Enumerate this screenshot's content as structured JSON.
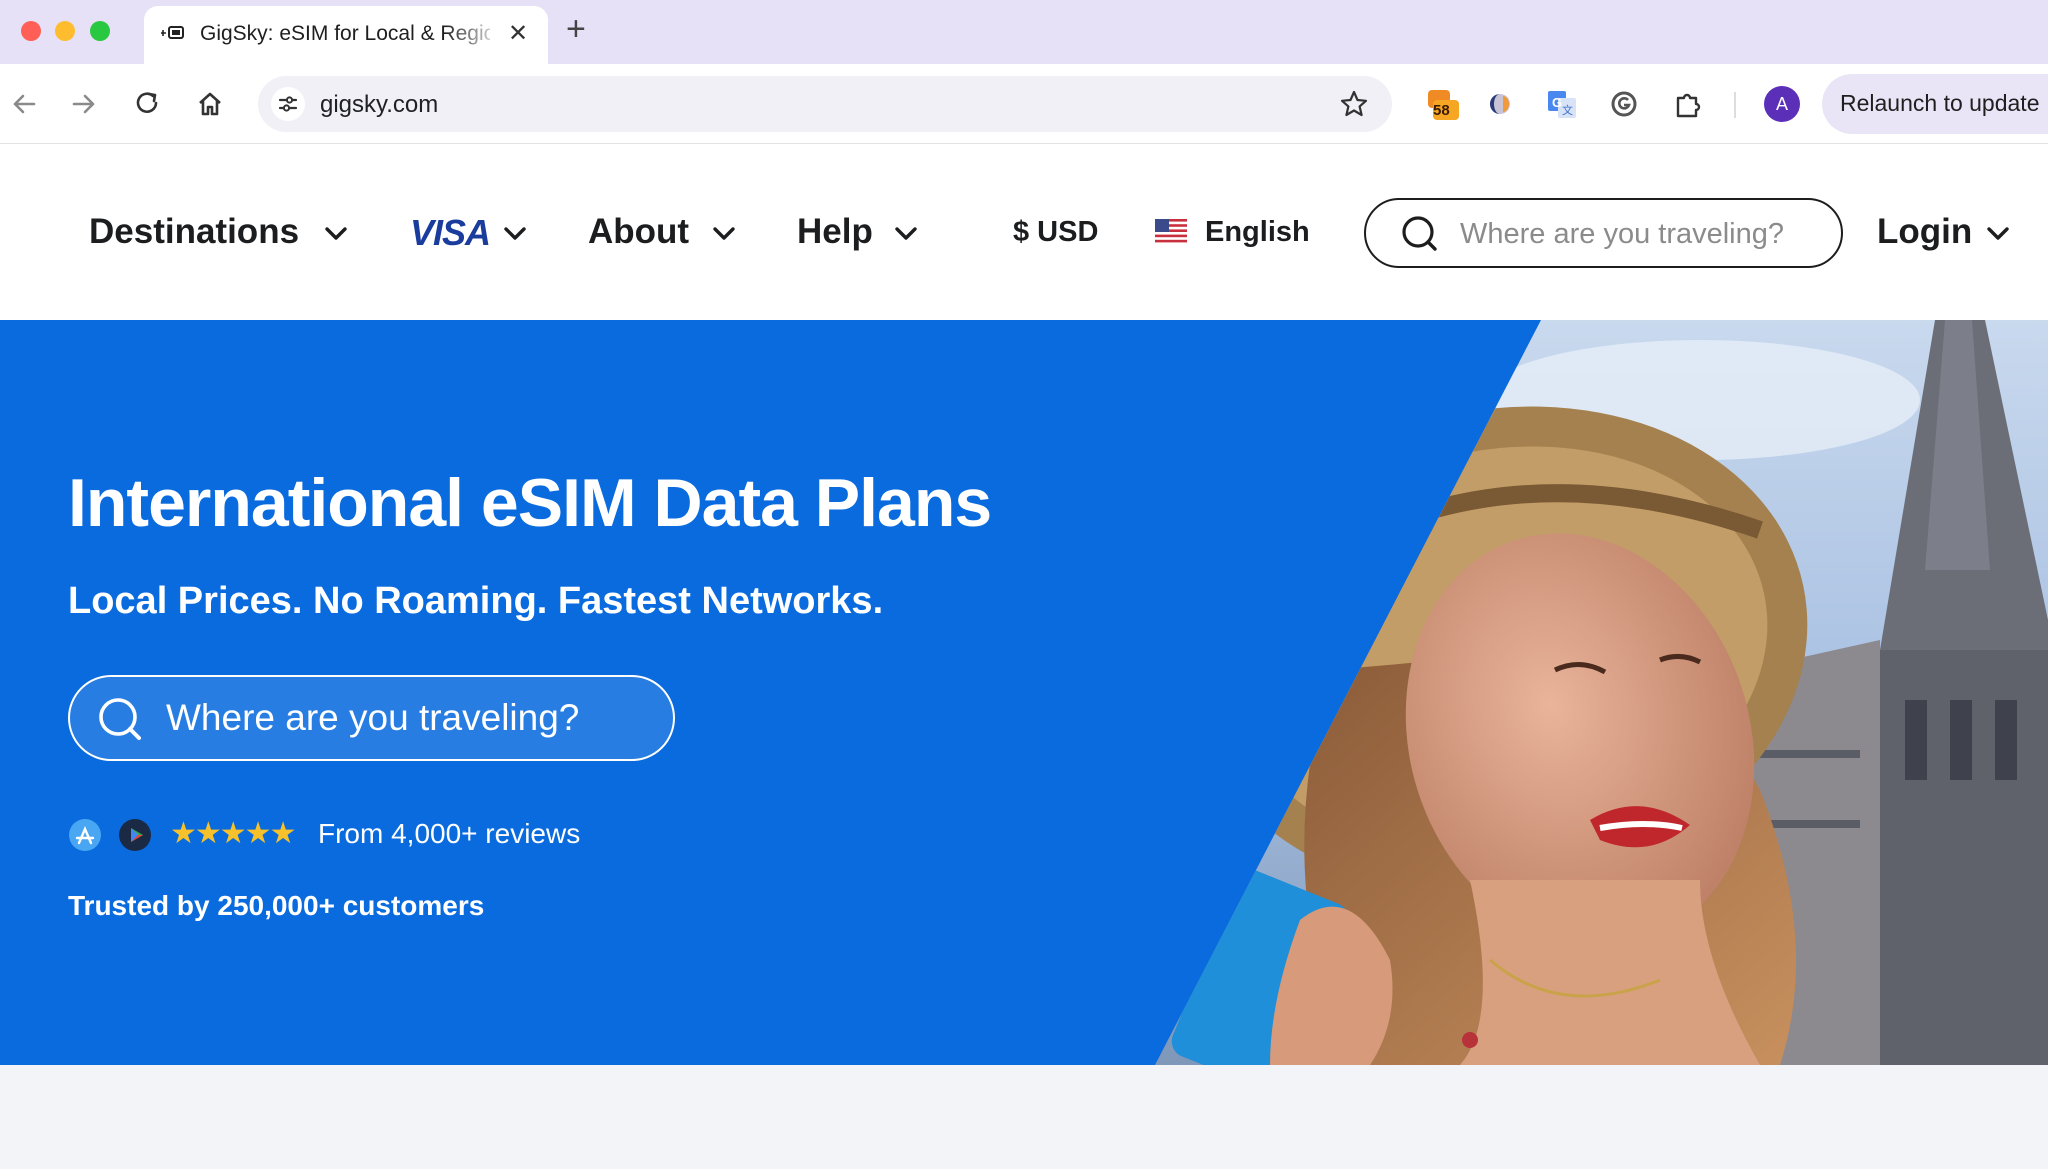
{
  "browser": {
    "tab_title": "GigSky: eSIM for Local & Regional Data",
    "tab_favicon": "gigsky-sim-icon",
    "new_tab_label": "+",
    "close_label": "✕",
    "url": "gigsky.com",
    "extension_badge": "58",
    "profile_initial": "A",
    "relaunch_label": "Relaunch to update"
  },
  "header": {
    "nav": [
      {
        "label": "Destinations"
      },
      {
        "label": "VISA"
      },
      {
        "label": "About"
      },
      {
        "label": "Help"
      }
    ],
    "currency": "$ USD",
    "language": "English",
    "search_placeholder": "Where are you traveling?",
    "login_label": "Login"
  },
  "hero": {
    "title": "International eSIM Data Plans",
    "subtitle": "Local Prices. No Roaming. Fastest Networks.",
    "search_placeholder": "Where are you traveling?",
    "stars": "★★★★★",
    "reviews_text": "From 4,000+ reviews",
    "trusted_text": "Trusted by 250,000+ customers"
  },
  "colors": {
    "brand_blue": "#0a6bde",
    "visa_blue": "#1a3c9c",
    "star_gold": "#f6c12b",
    "chrome_tab_strip": "#e6e1f7"
  }
}
